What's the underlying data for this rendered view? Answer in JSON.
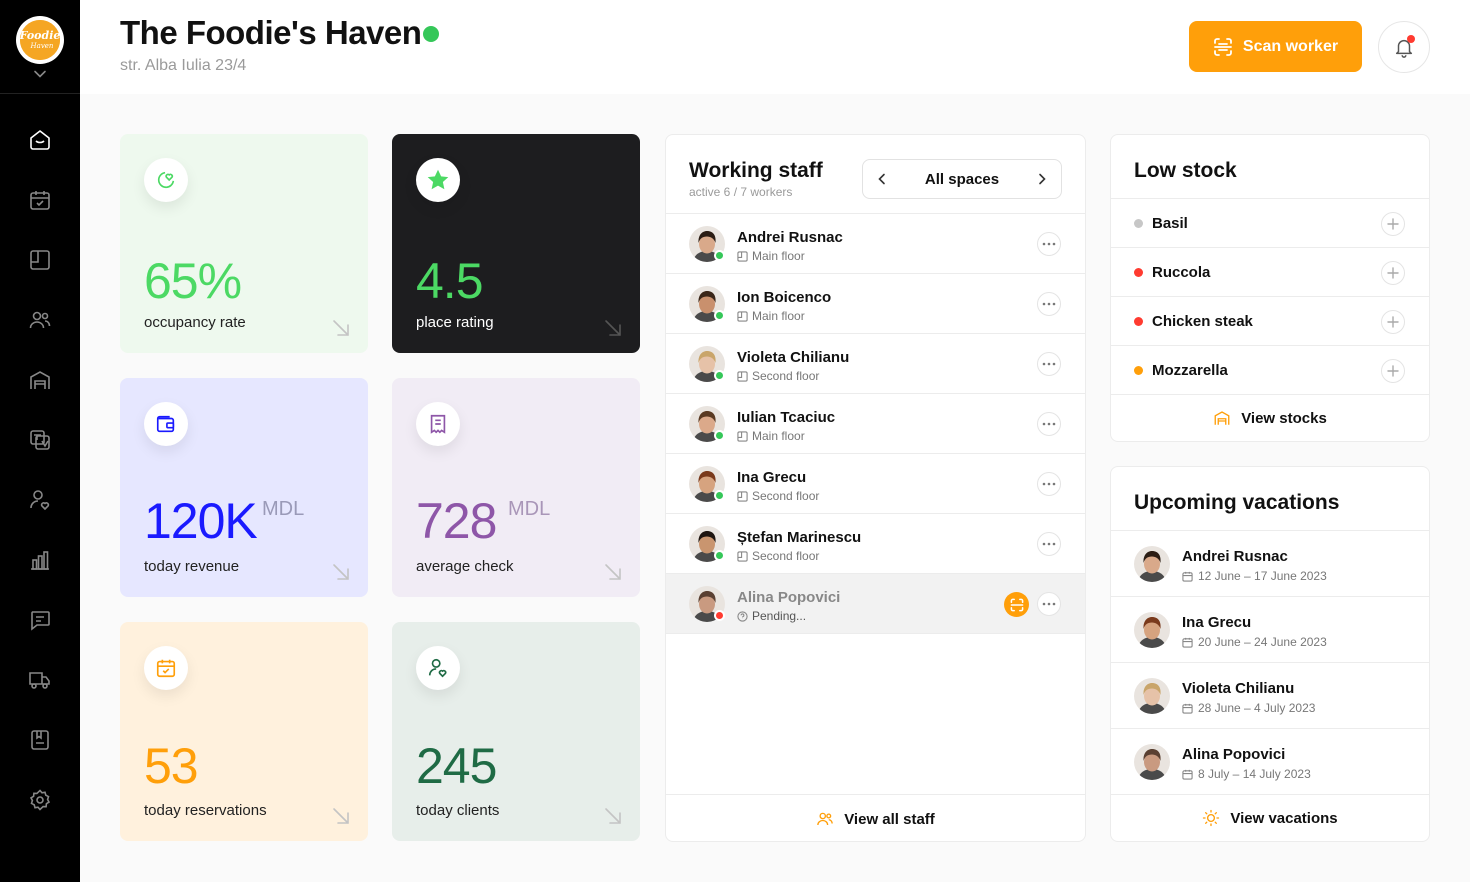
{
  "header": {
    "title": "The Foodie's Haven",
    "address": "str. Alba Iulia 23/4",
    "scan_label": "Scan worker",
    "status_color": "#35c759"
  },
  "logo": {
    "text": "Foodie's Haven"
  },
  "sidebar": {
    "items": [
      {
        "icon": "home-icon"
      },
      {
        "icon": "calendar-check-icon"
      },
      {
        "icon": "layout-icon"
      },
      {
        "icon": "users-icon"
      },
      {
        "icon": "store-icon"
      },
      {
        "icon": "translate-icon"
      },
      {
        "icon": "user-heart-icon"
      },
      {
        "icon": "bar-chart-icon"
      },
      {
        "icon": "chat-icon"
      },
      {
        "icon": "truck-icon"
      },
      {
        "icon": "menu-book-icon"
      },
      {
        "icon": "settings-icon"
      }
    ]
  },
  "stats": [
    {
      "value": "65%",
      "unit": "",
      "label": "occupancy rate",
      "bg": "#eef9ee",
      "color": "#4cd964",
      "icon": "pie-heart-icon"
    },
    {
      "value": "4.5",
      "unit": "",
      "label": "place rating",
      "bg": "#1d1d1f",
      "color": "#4cd964",
      "icon": "star-icon"
    },
    {
      "value": "120K",
      "unit": "MDL",
      "label": "today revenue",
      "bg": "#e6e7ff",
      "color": "#1a1aff",
      "icon": "wallet-icon"
    },
    {
      "value": "728",
      "unit": "MDL",
      "label": "average check",
      "bg": "#f1ecf5",
      "color": "#8e56a8",
      "icon": "receipt-icon"
    },
    {
      "value": "53",
      "unit": "",
      "label": "today reservations",
      "bg": "#fff1dd",
      "color": "#ff9f0a",
      "icon": "calendar-icon"
    },
    {
      "value": "245",
      "unit": "",
      "label": "today clients",
      "bg": "#e7eeea",
      "color": "#1f6b45",
      "icon": "user-heart-icon"
    }
  ],
  "staff": {
    "title": "Working staff",
    "subtitle": "active 6 / 7 workers",
    "filter": "All spaces",
    "view_all": "View all staff",
    "workers": [
      {
        "name": "Andrei Rusnac",
        "location": "Main floor",
        "status": "#35c759",
        "skin": "#d9a98a",
        "hair": "#2b1d14"
      },
      {
        "name": "Ion Boicenco",
        "location": "Main floor",
        "status": "#35c759",
        "skin": "#c9906d",
        "hair": "#3a2618"
      },
      {
        "name": "Violeta Chilianu",
        "location": "Second floor",
        "status": "#35c759",
        "skin": "#e6c2a8",
        "hair": "#c9a56a"
      },
      {
        "name": "Iulian Tcaciuc",
        "location": "Main floor",
        "status": "#35c759",
        "skin": "#dba98a",
        "hair": "#5a3a22"
      },
      {
        "name": "Ina Grecu",
        "location": "Second floor",
        "status": "#35c759",
        "skin": "#d6a37f",
        "hair": "#7a3a1c"
      },
      {
        "name": "Ștefan Marinescu",
        "location": "Second floor",
        "status": "#35c759",
        "skin": "#c9956f",
        "hair": "#1e1510"
      },
      {
        "name": "Alina Popovici",
        "location": "Pending...",
        "status": "#ff3b30",
        "skin": "#c99a80",
        "hair": "#5a4032",
        "pending": true
      }
    ]
  },
  "low_stock": {
    "title": "Low stock",
    "view_label": "View stocks",
    "items": [
      {
        "name": "Basil",
        "color": "#c7c7c7"
      },
      {
        "name": "Ruccola",
        "color": "#ff3b30"
      },
      {
        "name": "Chicken steak",
        "color": "#ff3b30"
      },
      {
        "name": "Mozzarella",
        "color": "#ff9f0a"
      }
    ]
  },
  "vacations": {
    "title": "Upcoming vacations",
    "view_label": "View vacations",
    "items": [
      {
        "name": "Andrei Rusnac",
        "dates": "12 June – 17 June 2023",
        "skin": "#d9a98a",
        "hair": "#2b1d14"
      },
      {
        "name": "Ina Grecu",
        "dates": "20 June – 24 June 2023",
        "skin": "#d6a37f",
        "hair": "#7a3a1c"
      },
      {
        "name": "Violeta Chilianu",
        "dates": "28 June – 4 July 2023",
        "skin": "#e6c2a8",
        "hair": "#c9a56a"
      },
      {
        "name": "Alina Popovici",
        "dates": "8 July – 14 July 2023",
        "skin": "#c99a80",
        "hair": "#5a4032"
      }
    ]
  }
}
